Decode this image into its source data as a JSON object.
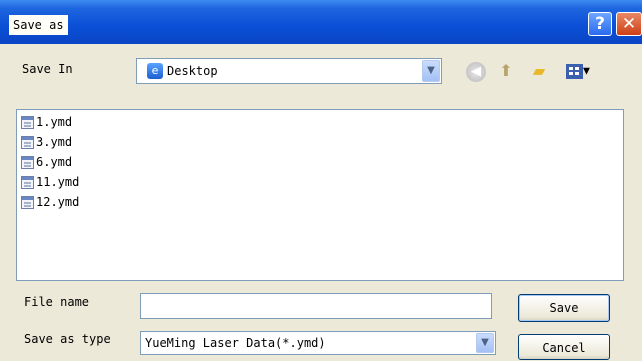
{
  "window": {
    "title": "Save as",
    "help_symbol": "?",
    "close_symbol": "✕"
  },
  "toolbar": {
    "save_in_label": "Save In",
    "location": "Desktop",
    "location_icon": "desktop-icon",
    "icons": [
      "back-icon",
      "up-folder-icon",
      "new-folder-icon",
      "views-icon"
    ]
  },
  "files": [
    "1.ymd",
    "3.ymd",
    "6.ymd",
    "11.ymd",
    "12.ymd"
  ],
  "form": {
    "file_name_label": "File name",
    "file_name_value": "",
    "save_as_type_label": "Save as type",
    "save_as_type_value": "YueMing Laser Data(*.ymd)",
    "save_label": "Save",
    "cancel_label": "Cancel"
  }
}
